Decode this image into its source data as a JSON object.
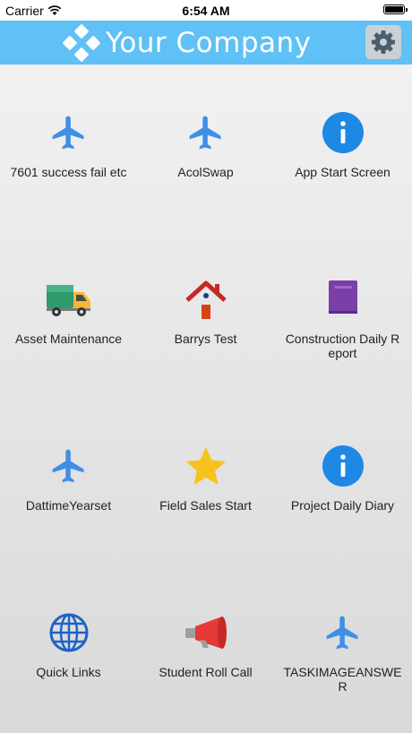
{
  "status": {
    "carrier": "Carrier",
    "time": "6:54 AM"
  },
  "header": {
    "title": "Your Company",
    "settings_icon": "gear-icon"
  },
  "colors": {
    "header_bg": "#5fc1f5",
    "airplane": "#3f8fe6",
    "info": "#1e88e5",
    "star": "#f7c21c",
    "book": "#7b3fa8",
    "megaphone": "#e53935"
  },
  "apps": [
    {
      "label": "7601 success fail etc",
      "icon": "airplane-icon"
    },
    {
      "label": "AcolSwap",
      "icon": "airplane-icon"
    },
    {
      "label": "App Start Screen",
      "icon": "info-icon"
    },
    {
      "label": "Asset Maintenance",
      "icon": "truck-icon"
    },
    {
      "label": "Barrys Test",
      "icon": "house-icon"
    },
    {
      "label": "Construction Daily Report",
      "icon": "book-icon"
    },
    {
      "label": "DattimeYearset",
      "icon": "airplane-icon"
    },
    {
      "label": "Field Sales Start",
      "icon": "star-icon"
    },
    {
      "label": "Project Daily Diary",
      "icon": "info-icon"
    },
    {
      "label": "Quick Links",
      "icon": "globe-icon"
    },
    {
      "label": "Student Roll Call",
      "icon": "megaphone-icon"
    },
    {
      "label": "TASKIMAGEANSWER",
      "icon": "airplane-icon"
    }
  ]
}
